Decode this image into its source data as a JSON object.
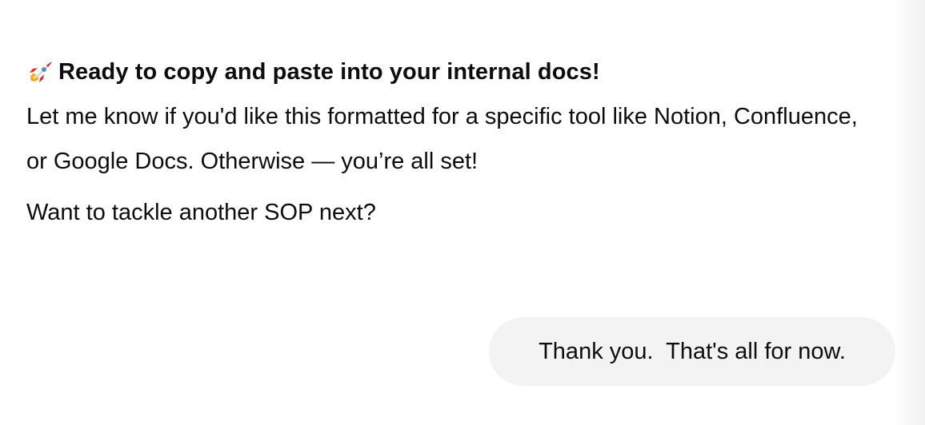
{
  "assistant": {
    "headline_icon": "rocket-icon",
    "headline": "Ready to copy and paste into your internal docs!",
    "paragraph_1": "Let me know if you'd like this formatted for a specific tool like Notion, Confluence, or Google Docs. Otherwise — you’re all set!",
    "paragraph_2": "Want to tackle another SOP next?"
  },
  "user": {
    "message": "Thank you.  That's all for now."
  }
}
